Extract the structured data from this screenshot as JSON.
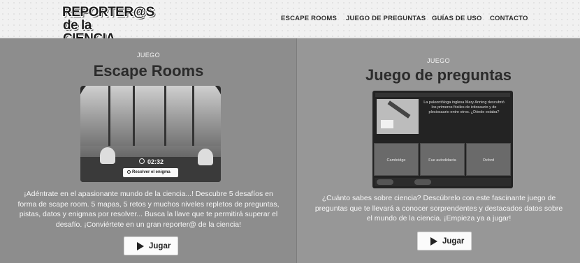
{
  "header": {
    "logo_line1": "REPORTER@S",
    "logo_line2": "de la CIENCIA",
    "nav": [
      "ESCAPE ROOMS",
      "JUEGO DE PREGUNTAS",
      "GUÍAS DE USO",
      "CONTACTO"
    ]
  },
  "escape": {
    "eyebrow": "JUEGO",
    "title": "Escape Rooms",
    "timer": "02:32",
    "enigma_button": "Resolver el enigma",
    "description": "¡Adéntrate en el apasionante mundo de la ciencia...! Descubre 5 desafíos en forma de scape room. 5 mapas, 5 retos y muchos niveles repletos de preguntas, pistas, datos y enigmas por resolver... Busca la llave que te permitirá superar el desafío. ¡Conviértete en un gran reporter@ de la ciencia!",
    "play_button": "Jugar"
  },
  "quiz": {
    "eyebrow": "JUEGO",
    "title": "Juego de preguntas",
    "question": "La paleontóloga inglesa Mary Anning descubrió los primeros fósiles de ictiosaurio y de plesiosaurio entre otros. ¿Dónde estaba?",
    "options": [
      "Cambridge",
      "Fue autodidacta",
      "Oxford"
    ],
    "description": "¿Cuánto sabes sobre ciencia? Descúbrelo con este fascinante juego de preguntas que te llevará a conocer sorprendentes y destacados datos sobre el mundo de la ciencia. ¡Empieza ya a jugar!",
    "play_button": "Jugar"
  },
  "colors": {
    "header_bg": "#f1f1f1",
    "panel_left": "#8d8d8d",
    "panel_right": "#979797",
    "title_text": "#2b2b2b",
    "button_bg": "#fbfbfb"
  },
  "icons": [
    "play-icon",
    "clock-icon",
    "key-icon"
  ]
}
